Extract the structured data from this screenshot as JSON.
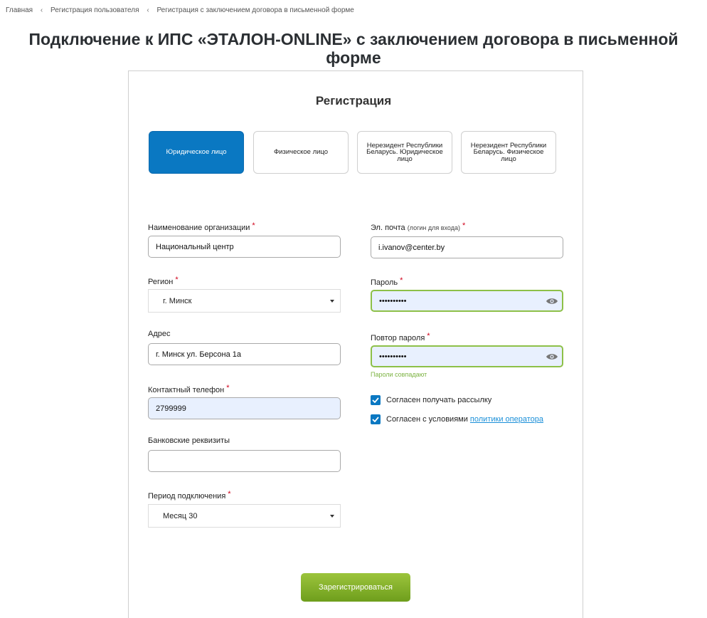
{
  "breadcrumb": {
    "items": [
      "Главная",
      "Регистрация пользователя",
      "Регистрация с заключением договора в письменной форме"
    ],
    "separator": "‹"
  },
  "page_title": "Подключение к ИПС «ЭТАЛОН-ONLINE» с заключением договора в письменной форме",
  "form": {
    "title": "Регистрация",
    "types": [
      {
        "label": "Юридическое лицо",
        "active": true
      },
      {
        "label": "Физическое лицо",
        "active": false
      },
      {
        "label": "Нерезидент Республики Беларусь. Юридическое лицо",
        "active": false
      },
      {
        "label": "Нерезидент Республики Беларусь. Физическое лицо",
        "active": false
      }
    ],
    "org_name": {
      "label": "Наименование организации",
      "required": "*",
      "value": "Национальный центр"
    },
    "region": {
      "label": "Регион",
      "required": "*",
      "value": "г. Минск"
    },
    "address": {
      "label": "Адрес",
      "value": "г. Минск ул. Берсона 1а"
    },
    "phone": {
      "label": "Контактный телефон",
      "required": "*",
      "value": "2799999"
    },
    "bank": {
      "label": "Банковские реквизиты",
      "value": ""
    },
    "period": {
      "label": "Период подключения",
      "required": "*",
      "value": "Месяц 30"
    },
    "email": {
      "label": "Эл. почта",
      "label_note": "(логин для входа)",
      "required": "*",
      "value": "i.ivanov@center.by"
    },
    "password": {
      "label": "Пароль",
      "required": "*",
      "value": "••••••••••"
    },
    "password_repeat": {
      "label": "Повтор пароля",
      "required": "*",
      "value": "••••••••••",
      "hint": "Пароли совпадают"
    },
    "newsletter": {
      "label": "Согласен получать рассылку",
      "checked": true
    },
    "terms": {
      "label": "Согласен с условиями ",
      "link": "политики оператора",
      "checked": true
    },
    "submit_label": "Зарегистрироваться"
  },
  "colors": {
    "accent": "#0a78c2",
    "submit": "#84b02c",
    "success": "#8dc048",
    "required": "#d0021b"
  }
}
